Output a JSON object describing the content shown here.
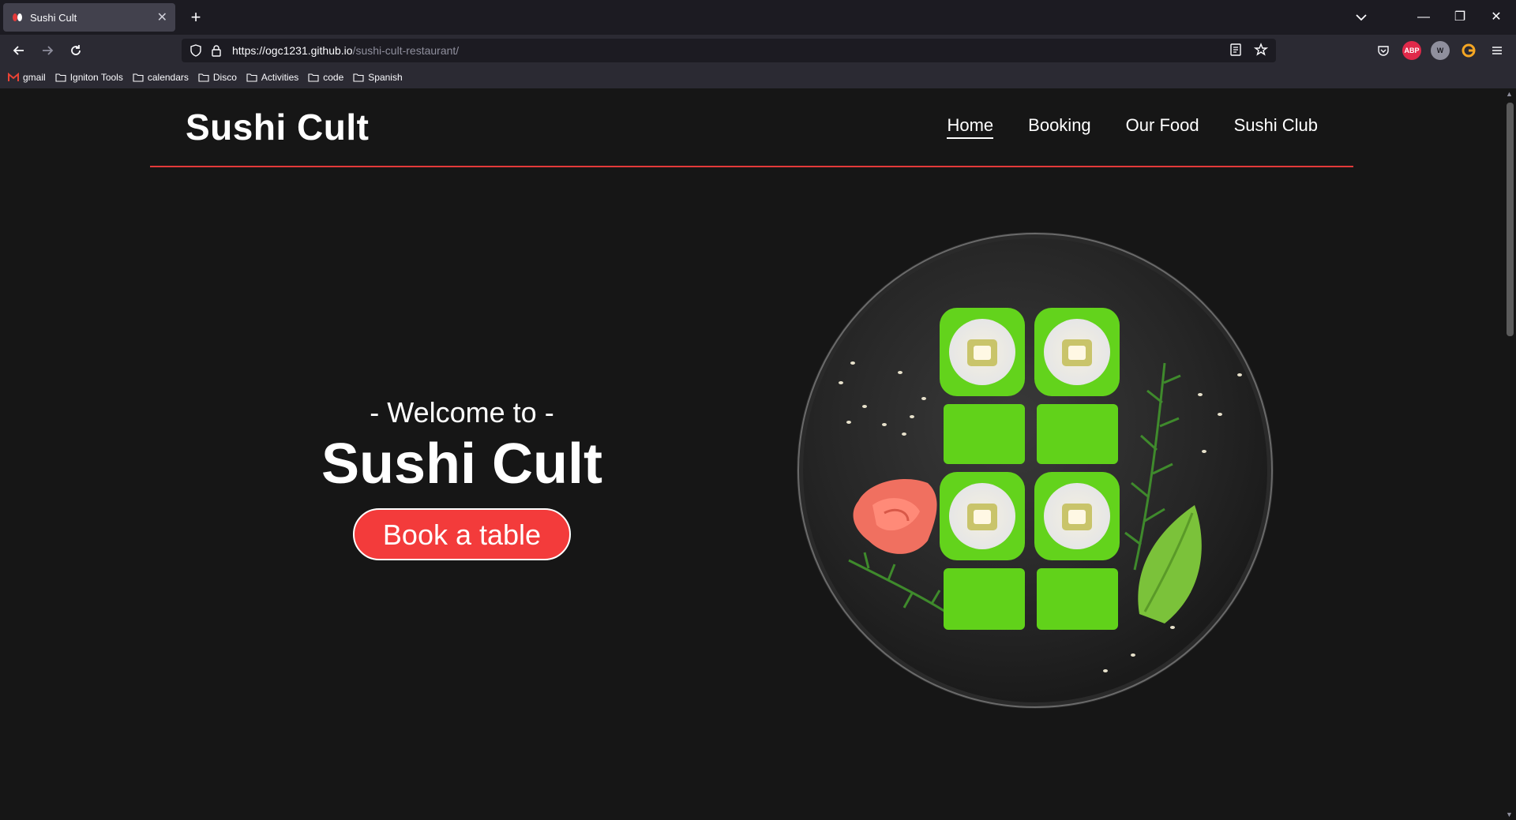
{
  "browser": {
    "tab_title": "Sushi Cult",
    "url_host": "https://ogc1231.github.io",
    "url_path": "/sushi-cult-restaurant/",
    "bookmarks": [
      "gmail",
      "Igniton Tools",
      "calendars",
      "Disco",
      "Activities",
      "code",
      "Spanish"
    ],
    "extensions": [
      "ABP",
      "W"
    ]
  },
  "site": {
    "logo": "Sushi Cult",
    "nav": [
      "Home",
      "Booking",
      "Our Food",
      "Sushi Club"
    ],
    "active_nav": "Home"
  },
  "hero": {
    "subtitle": "- Welcome to -",
    "title": "Sushi Cult",
    "cta": "Book a table"
  },
  "colors": {
    "accent": "#f33b3b",
    "background": "#161616",
    "roll_green": "#63d31c"
  }
}
